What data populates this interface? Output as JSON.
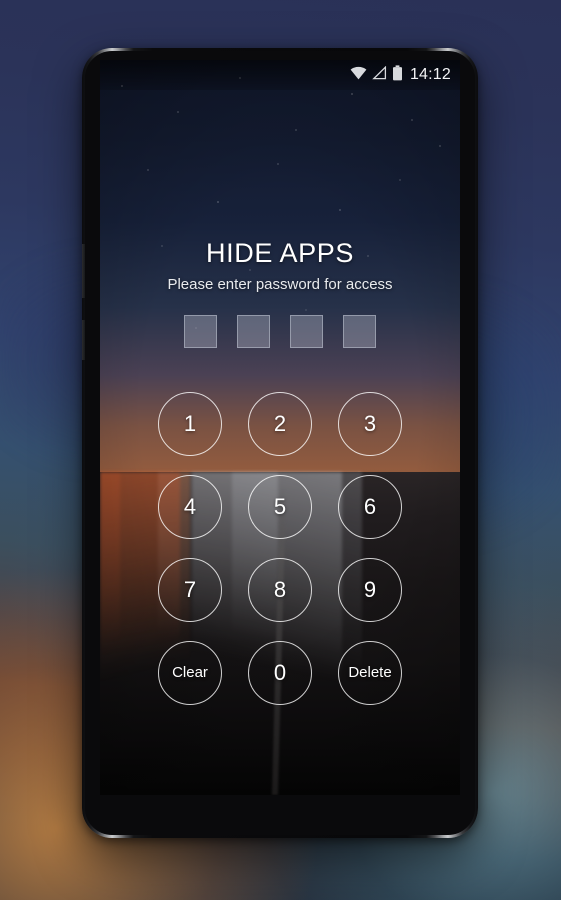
{
  "background": {
    "description": "blurred sunset cityscape backdrop",
    "colors": {
      "top": "#2a3157",
      "mid_blue": "#31436e",
      "warm_glow": "#e89642",
      "teal_glow": "#78b2c4",
      "bottom": "#24303e"
    }
  },
  "device": {
    "name": "android-smartphone",
    "bezel_color": "#0a0a0c",
    "edge_highlight": "#c9cbcd",
    "hardware": {
      "earpiece": "earpiece-speaker",
      "front_camera": "front-camera",
      "proximity_sensor": "proximity-sensor",
      "volume_up": "volume-up-key",
      "volume_down": "volume-down-key"
    }
  },
  "wallpaper": {
    "description": "night highway with light trails under a starry sky",
    "sky_color": "#17213a",
    "sunset_color": "#9b5f3d",
    "road_color": "#141213"
  },
  "status_bar": {
    "wifi_icon": "wifi-icon",
    "signal_icon": "signal-no-service-icon",
    "battery_icon": "battery-full-icon",
    "time": "14:12",
    "text_color": "#f2f3f5"
  },
  "lock_screen": {
    "title": "HIDE APPS",
    "subtitle": "Please enter password for access",
    "password_length": 4,
    "password_entered": 0,
    "password_boxes": [
      "",
      "",
      "",
      ""
    ],
    "keypad": [
      {
        "label": "1",
        "name": "key-1",
        "type": "digit"
      },
      {
        "label": "2",
        "name": "key-2",
        "type": "digit"
      },
      {
        "label": "3",
        "name": "key-3",
        "type": "digit"
      },
      {
        "label": "4",
        "name": "key-4",
        "type": "digit"
      },
      {
        "label": "5",
        "name": "key-5",
        "type": "digit"
      },
      {
        "label": "6",
        "name": "key-6",
        "type": "digit"
      },
      {
        "label": "7",
        "name": "key-7",
        "type": "digit"
      },
      {
        "label": "8",
        "name": "key-8",
        "type": "digit"
      },
      {
        "label": "9",
        "name": "key-9",
        "type": "digit"
      },
      {
        "label": "Clear",
        "name": "key-clear",
        "type": "action"
      },
      {
        "label": "0",
        "name": "key-0",
        "type": "digit"
      },
      {
        "label": "Delete",
        "name": "key-delete",
        "type": "action"
      }
    ],
    "text_color": "#ffffff"
  }
}
